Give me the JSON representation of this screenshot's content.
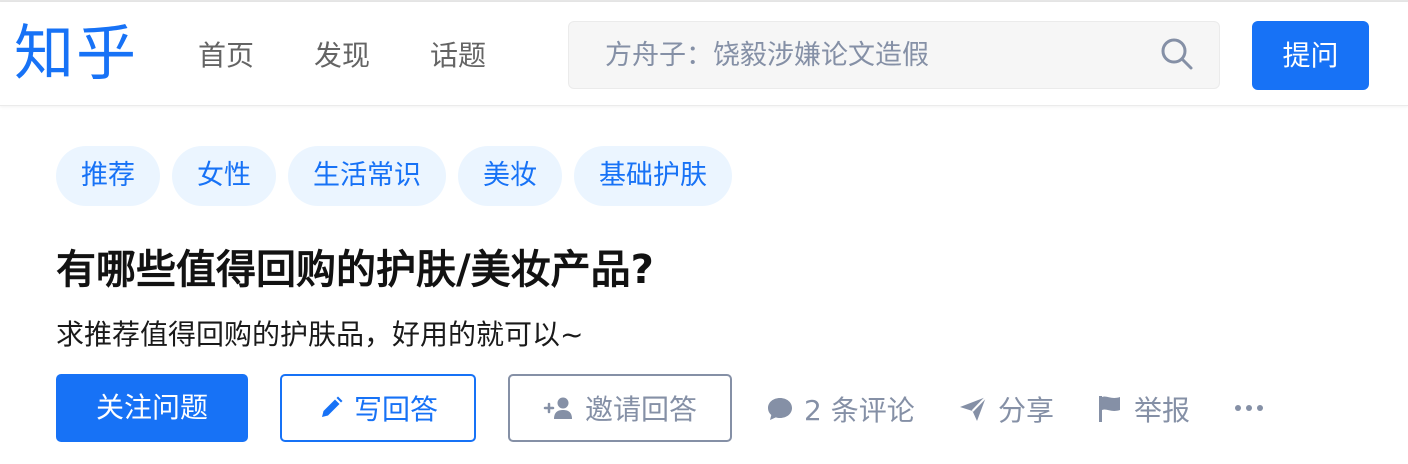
{
  "header": {
    "logo": "知乎",
    "nav": [
      "首页",
      "发现",
      "话题"
    ],
    "search": {
      "placeholder": "方舟子：饶毅涉嫌论文造假"
    },
    "ask_label": "提问"
  },
  "question": {
    "tags": [
      "推荐",
      "女性",
      "生活常识",
      "美妆",
      "基础护肤"
    ],
    "title": "有哪些值得回购的护肤/美妆产品?",
    "detail": "求推荐值得回购的护肤品，好用的就可以~"
  },
  "actions": {
    "follow_label": "关注问题",
    "write_label": "写回答",
    "invite_label": "邀请回答",
    "comments_label": "2 条评论",
    "share_label": "分享",
    "report_label": "举报"
  },
  "icons": {
    "search": "search-icon",
    "write": "pencil-icon",
    "invite": "add-user-icon",
    "comment": "comment-bubble-icon",
    "share": "paper-plane-icon",
    "report": "flag-icon",
    "more": "more-dots-icon"
  },
  "colors": {
    "brand": "#1772f6",
    "tag_bg": "#ebf5ff",
    "muted": "#8590a6",
    "nav_text": "#646464"
  }
}
